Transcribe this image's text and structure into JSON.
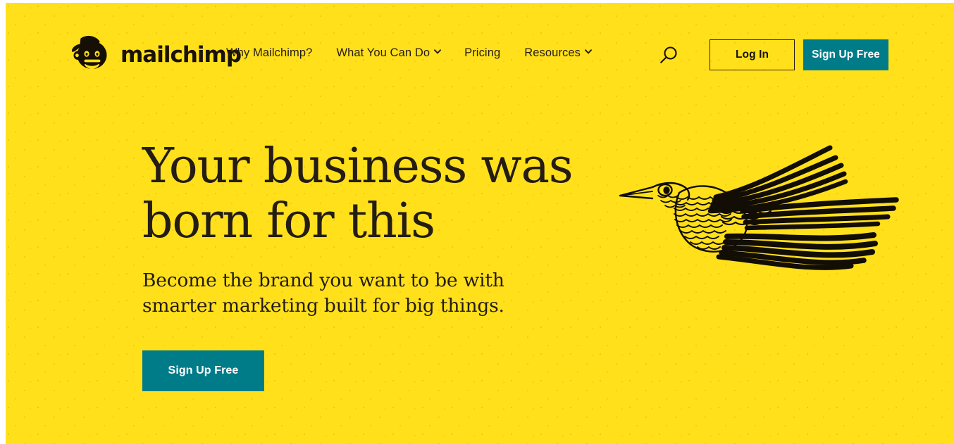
{
  "theme": {
    "background": "#FFE01B",
    "accent_teal": "#007C89",
    "text_dark": "#241c15",
    "button_text_light": "#ffffff"
  },
  "header": {
    "logo": {
      "mark_icon": "freddie-chimp-icon",
      "wordmark": "mailchimp"
    },
    "nav_items": [
      {
        "label": "Why Mailchimp?",
        "has_dropdown": false
      },
      {
        "label": "What You Can Do",
        "has_dropdown": true
      },
      {
        "label": "Pricing",
        "has_dropdown": false
      },
      {
        "label": "Resources",
        "has_dropdown": true
      }
    ],
    "search_icon": "search-icon",
    "login_label": "Log In",
    "signup_label": "Sign Up Free"
  },
  "hero": {
    "headline_line1": "Your business was",
    "headline_line2": "born for this",
    "subhead_line1": "Become the brand you want to be with",
    "subhead_line2": "smarter marketing built for big things.",
    "cta_label": "Sign Up Free",
    "illustration": "flying-bird-illustration"
  }
}
